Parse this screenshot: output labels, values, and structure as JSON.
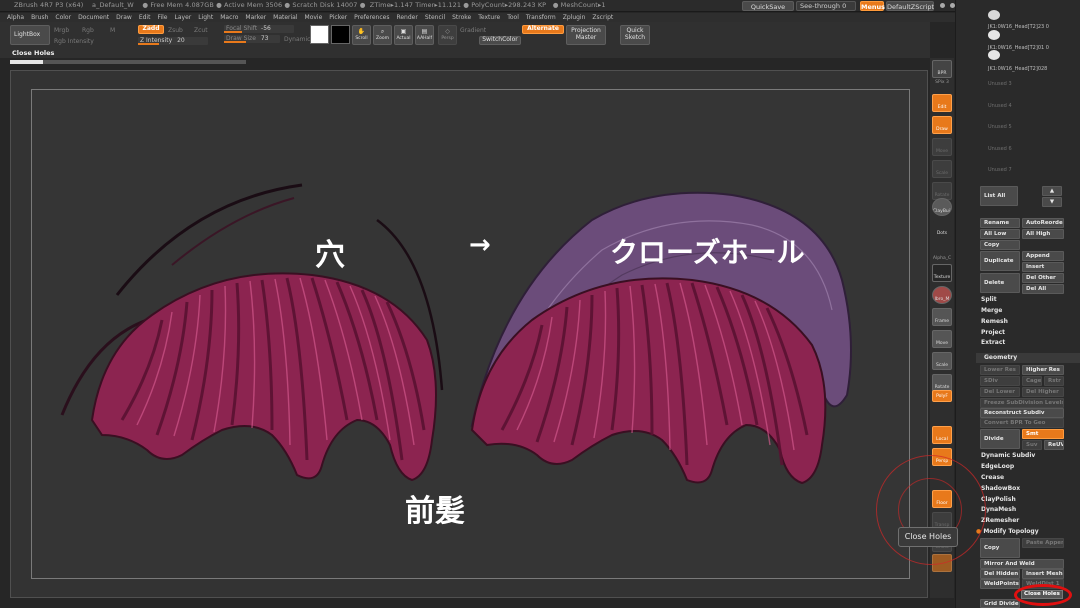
{
  "titlebar": {
    "info": "ZBrush 4R7 P3 (x64)    a_Default_W    ● Free Mem 4.087GB ● Active Mem 3506 ● Scratch Disk 14007 ●  ZTime▸1.147 Timer▸11.121 ● PolyCount▸298.243 KP   ● MeshCount▸1",
    "quicksave": "QuickSave",
    "seethrough": "See-through  0",
    "menus": "Menus",
    "script": "DefaultZScript"
  },
  "menubar": [
    "Alpha",
    "Brush",
    "Color",
    "Document",
    "Draw",
    "Edit",
    "File",
    "Layer",
    "Light",
    "Macro",
    "Marker",
    "Material",
    "Movie",
    "Picker",
    "Preferences",
    "Render",
    "Stencil",
    "Stroke",
    "Texture",
    "Tool",
    "Transform",
    "Zplugin",
    "Zscript"
  ],
  "shelf": {
    "lightbox": "LightBox",
    "mrgb": "Mrgb",
    "rgb": "Rgb",
    "m": "M",
    "zadd": "Zadd",
    "zsub": "Zsub",
    "zcut": "Zcut",
    "rgb_intensity": "Rgb Intensity",
    "z_intensity": "Z Intensity",
    "z_intensity_value": "20",
    "focal_shift": "Focal Shift",
    "focal_shift_value": "-56",
    "draw_size": "Draw Size",
    "draw_size_value": "73",
    "dynamic": "Dynamic",
    "scroll": "Scroll",
    "zoom": "Zoom",
    "actual": "Actual",
    "aahalf": "AAHalf",
    "persp": "Persp",
    "gradient": "Gradient",
    "switchcolor": "SwitchColor",
    "alternate": "Alternate",
    "projection_master": "Projection Master",
    "quick_sketch": "Quick Sketch",
    "current_action": "Close Holes",
    "swatch_main": "#ffffff",
    "swatch_secondary": "#000000",
    "progress": 0.14
  },
  "canvas": {
    "label_hole": "穴",
    "label_arrow": "→",
    "label_closehole": "クローズホール",
    "label_bangs": "前髪",
    "hair_color": "#b8386e",
    "fill_color": "#7d5a8c"
  },
  "rtool": {
    "bpr": "BPR",
    "spix": "SPix 3",
    "edit": "Edit",
    "draw": "Draw",
    "move": "Move",
    "scale": "Scale",
    "rotate": "Rotate",
    "claybuild": "ClayBuil",
    "dots": "Dots",
    "alpha": "Alpha_C",
    "texture": "Texture",
    "material": "Jbro_M",
    "frame": "Frame",
    "move2": "Move",
    "scale2": "Scale",
    "rotate2": "Rotate",
    "polyf": "PolyF",
    "local": "Local",
    "persp": "Persp",
    "floor": "Floor",
    "transp": "Transp",
    "ghost": "Ghost"
  },
  "rpanel": {
    "subtools": [
      "JK1:0W16_Head[T2]23 0",
      "JK1:0W16_Head[T2]01 0",
      "JK1:0W16_Head[T2]028"
    ],
    "unused": [
      "Unused 3",
      "Unused 4",
      "Unused 5",
      "Unused 6",
      "Unused 7"
    ],
    "list_all": "List All",
    "rename": "Rename",
    "autoreorder": "AutoReorder",
    "all_low": "All Low",
    "all_high": "All High",
    "copy": "Copy",
    "duplicate": "Duplicate",
    "append": "Append",
    "insert": "Insert",
    "delete": "Delete",
    "del_other": "Del Other",
    "del_all": "Del All",
    "split": "Split",
    "merge": "Merge",
    "remesh": "Remesh",
    "project": "Project",
    "extract": "Extract",
    "geometry": "Geometry",
    "lower_res": "Lower Res",
    "higher_res": "Higher Res",
    "sdiv": "SDiv",
    "cage": "Cage",
    "rstr": "Rstr",
    "del_lower": "Del Lower",
    "del_higher": "Del Higher",
    "freeze_subdiv": "Freeze SubDivision Levels",
    "reconstruct_subdiv": "Reconstruct Subdiv",
    "convert_bpr": "Convert BPR To Geo",
    "divide": "Divide",
    "smt": "Smt",
    "suv": "Suv",
    "relax": "ReUV",
    "dynamic_subdiv": "Dynamic Subdiv",
    "edgeloop": "EdgeLoop",
    "crease": "Crease",
    "shadowbox": "ShadowBox",
    "claypolish": "ClayPolish",
    "dynamesh": "DynaMesh",
    "zremesher": "ZRemesher",
    "modify_topology": "Modify Topology",
    "copy2": "Copy",
    "paste_append": "Paste Append",
    "mirror_weld": "Mirror And Weld",
    "del_hidden": "Del Hidden",
    "insert_mesh": "Insert Mesh",
    "weldpoints": "WeldPoints",
    "weldDist": "WeldDist 1",
    "close_holes": "Close Holes",
    "grid_divide": "Grid Divide"
  },
  "tooltip": "Close Holes"
}
